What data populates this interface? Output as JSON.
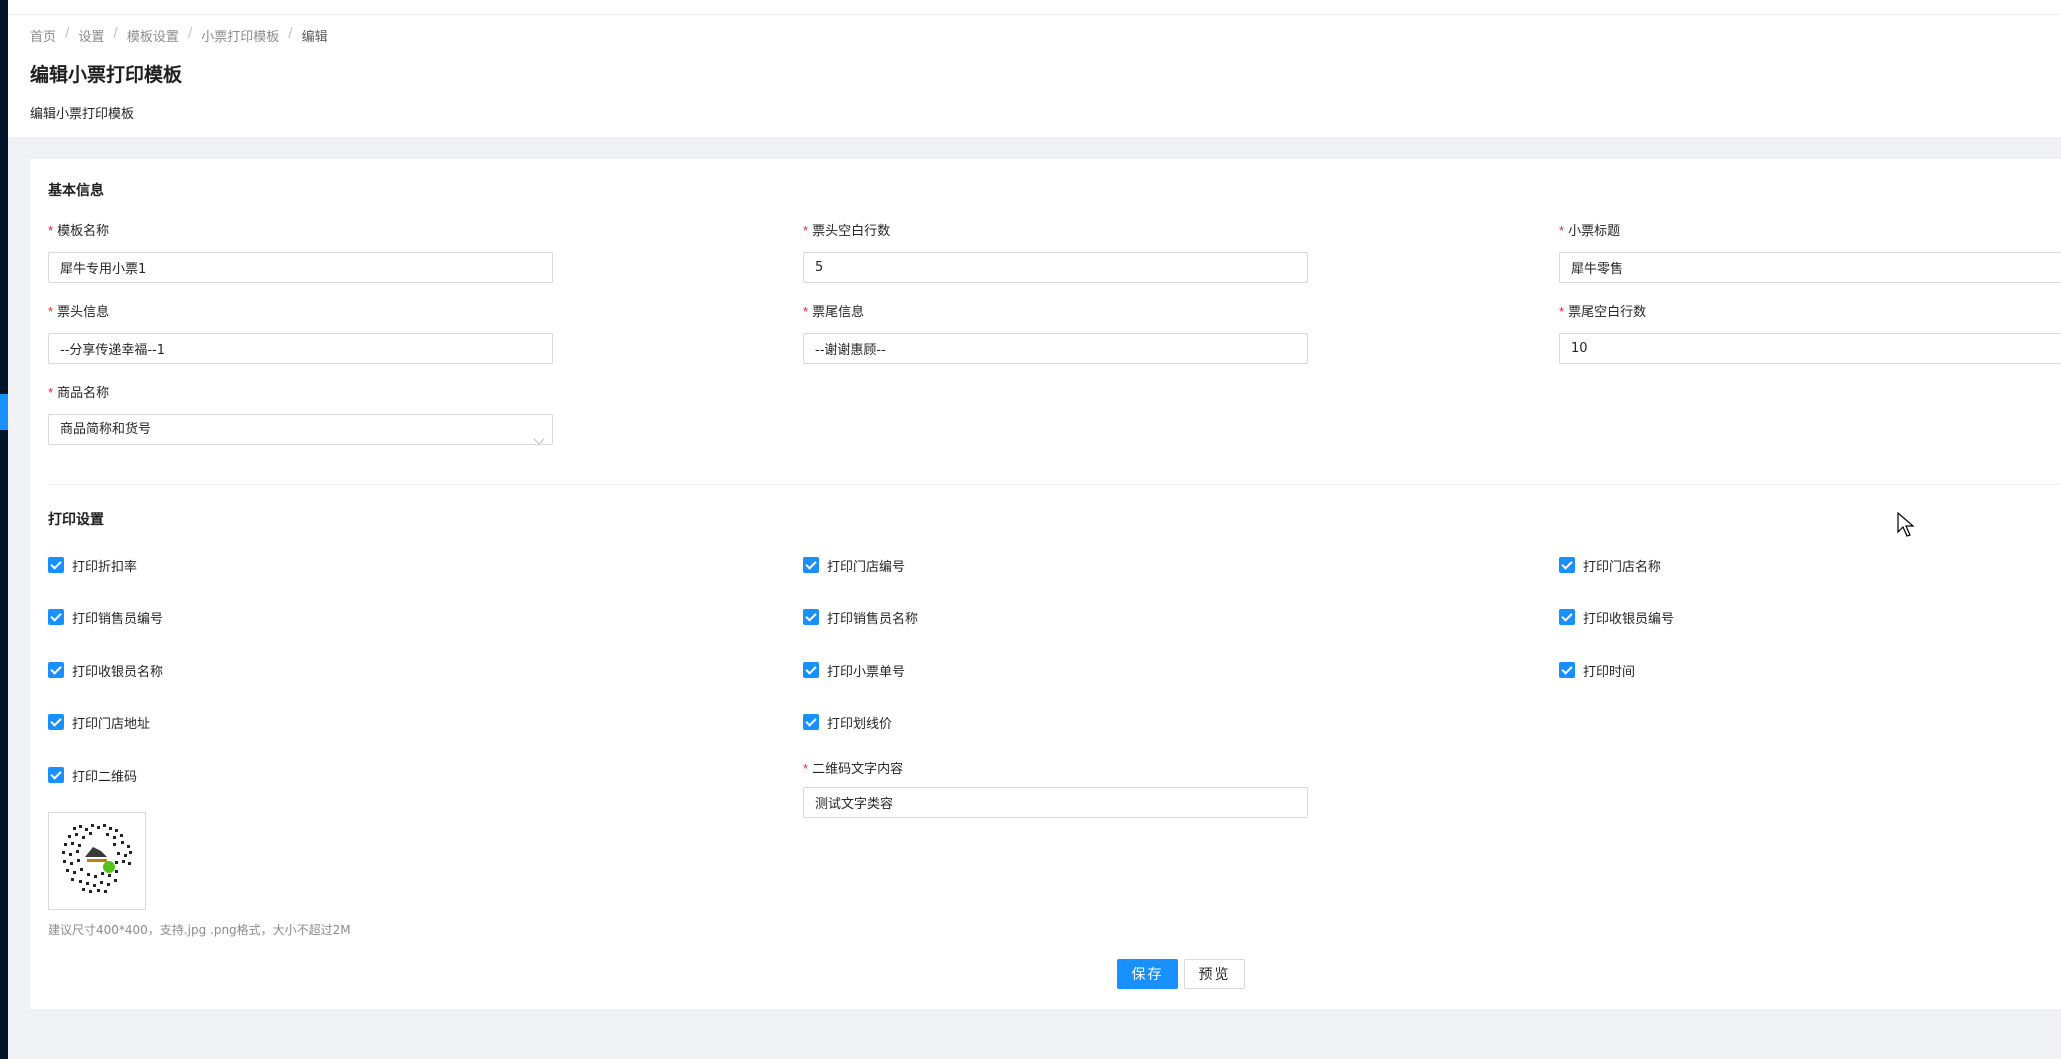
{
  "breadcrumb": [
    "首页",
    "设置",
    "模板设置",
    "小票打印模板",
    "编辑"
  ],
  "page": {
    "title": "编辑小票打印模板",
    "subtitle": "编辑小票打印模板"
  },
  "basic_info": {
    "section_title": "基本信息",
    "fields": {
      "template_name": {
        "label": "模板名称",
        "value": "犀牛专用小票1"
      },
      "header_blank_rows": {
        "label": "票头空白行数",
        "value": "5"
      },
      "receipt_title": {
        "label": "小票标题",
        "value": "犀牛零售"
      },
      "header_info": {
        "label": "票头信息",
        "value": "--分享传递幸福--1"
      },
      "footer_info": {
        "label": "票尾信息",
        "value": "--谢谢惠顾--"
      },
      "footer_blank_rows": {
        "label": "票尾空白行数",
        "value": "10"
      },
      "product_name": {
        "label": "商品名称",
        "value": "商品简称和货号"
      }
    }
  },
  "print_settings": {
    "section_title": "打印设置",
    "checkboxes": [
      {
        "label": "打印折扣率",
        "checked": true
      },
      {
        "label": "打印门店编号",
        "checked": true
      },
      {
        "label": "打印门店名称",
        "checked": true
      },
      {
        "label": "打印销售员编号",
        "checked": true
      },
      {
        "label": "打印销售员名称",
        "checked": true
      },
      {
        "label": "打印收银员编号",
        "checked": true
      },
      {
        "label": "打印收银员名称",
        "checked": true
      },
      {
        "label": "打印小票单号",
        "checked": true
      },
      {
        "label": "打印时间",
        "checked": true
      },
      {
        "label": "打印门店地址",
        "checked": true
      },
      {
        "label": "打印划线价",
        "checked": true
      },
      {
        "label": "打印二维码",
        "checked": true
      }
    ],
    "qr_text": {
      "label": "二维码文字内容",
      "value": "测试文字类容"
    },
    "upload_hint": "建议尺寸400*400，支持.jpg .png格式，大小不超过2M"
  },
  "actions": {
    "save_label": "保存",
    "preview_label": "预览"
  },
  "colors": {
    "primary": "#1890ff",
    "required": "#f5222d",
    "sidebar": "#001529"
  }
}
